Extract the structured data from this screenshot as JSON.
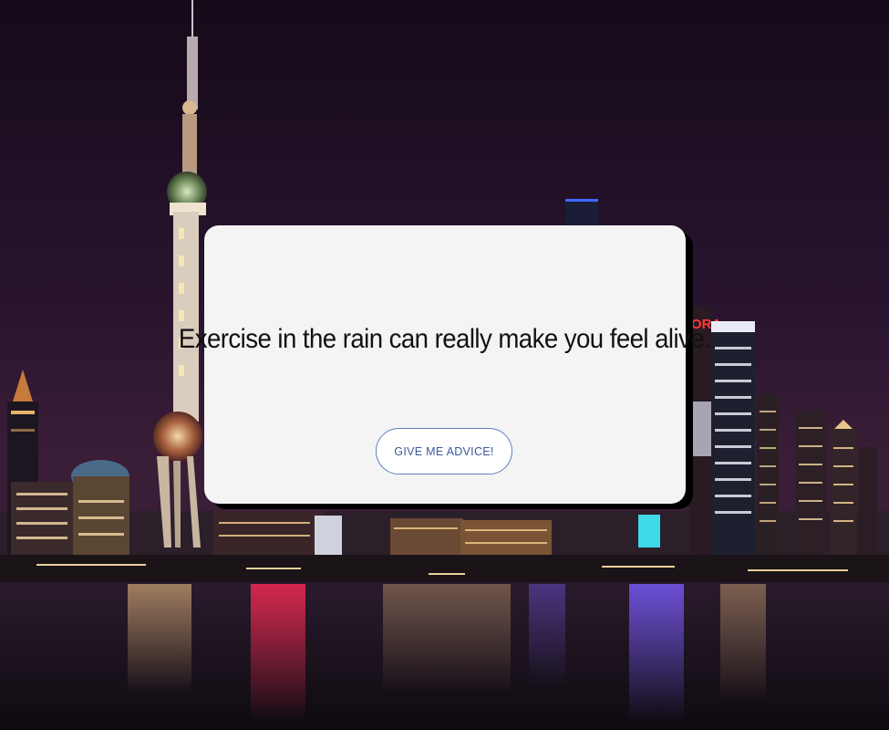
{
  "advice": {
    "text": "Exercise in the rain can really make you feel alive.",
    "button_label": "GIVE ME ADVICE!"
  },
  "background": {
    "description_icon": "city-skyline-night-background",
    "sign_text": "ORA"
  },
  "colors": {
    "card_background": "#f4f4f4",
    "card_shadow": "#000000",
    "button_border": "#5b7fbf",
    "button_text": "#3b5a9a",
    "sky": "#1a0f1f"
  }
}
